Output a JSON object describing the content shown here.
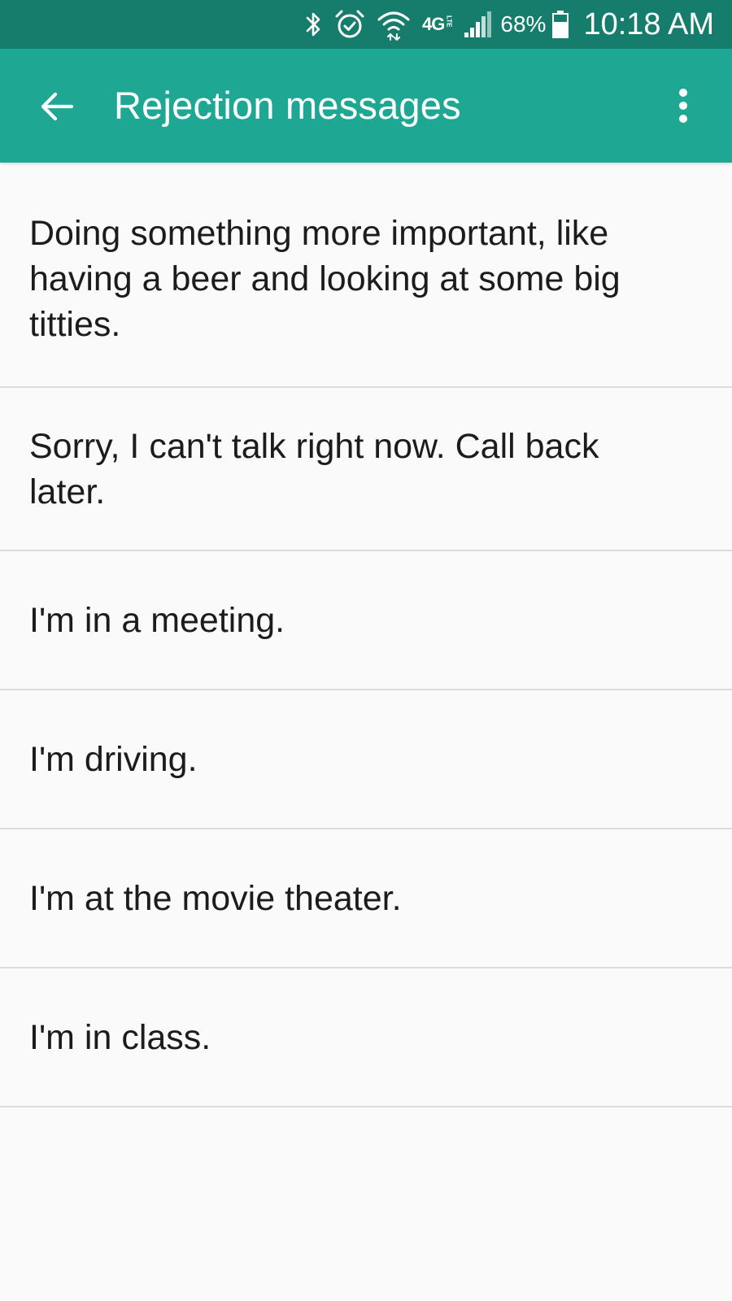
{
  "status_bar": {
    "icons": [
      "bluetooth-icon",
      "alarm-icon",
      "wifi-icon",
      "network-4g-lte-icon",
      "signal-icon",
      "battery-icon"
    ],
    "network_label": "4G",
    "network_sub": "LTE",
    "battery_percent": "68%",
    "battery_level": 0.68,
    "time": "10:18 AM"
  },
  "app_bar": {
    "title": "Rejection messages",
    "back_icon": "back-arrow-icon",
    "menu_icon": "more-vertical-icon"
  },
  "messages": [
    {
      "text": "Doing something more important, like having a beer and looking at some big titties."
    },
    {
      "text": "Sorry, I can't talk right now. Call back later."
    },
    {
      "text": "I'm in a meeting."
    },
    {
      "text": "I'm driving."
    },
    {
      "text": "I'm at the movie theater."
    },
    {
      "text": "I'm in class."
    }
  ],
  "colors": {
    "status_bar": "#167d6d",
    "app_bar": "#1ea894",
    "background": "#fafafa",
    "divider": "#dcdcdc",
    "text": "#1c1c1c"
  }
}
